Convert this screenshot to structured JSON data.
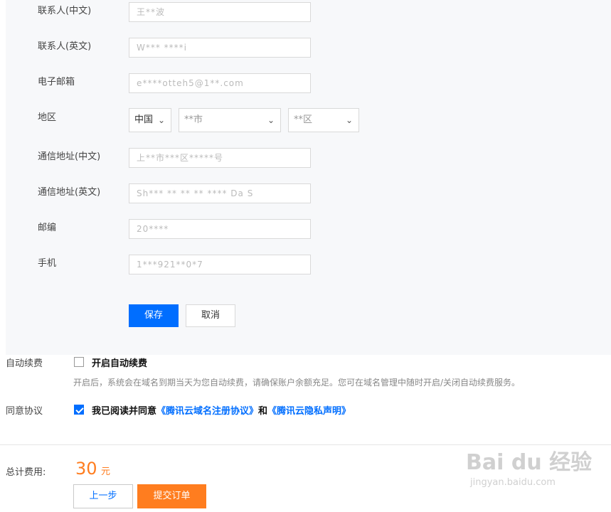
{
  "form": {
    "fields": [
      {
        "label": "联系人(中文)",
        "value": "王**波"
      },
      {
        "label": "联系人(英文)",
        "value": "W*** ****i"
      },
      {
        "label": "电子邮箱",
        "value": "e****otteh5@1**.com"
      },
      {
        "label": "通信地址(中文)",
        "value": "上**市***区*****号"
      },
      {
        "label": "通信地址(英文)",
        "value": "Sh*** ** ** ** **** Da S"
      },
      {
        "label": "邮编",
        "value": "20****"
      },
      {
        "label": "手机",
        "value": "1***921**0*7"
      }
    ],
    "region": {
      "label": "地区",
      "country": "中国",
      "province": "**市",
      "city": "**区"
    },
    "save_label": "保存",
    "cancel_label": "取消"
  },
  "auto_renew": {
    "label": "自动续费",
    "checkbox_label": "开启自动续费",
    "checked": false,
    "description": "开启后，系统会在域名到期当天为您自动续费，请确保账户余额充足。您可在域名管理中随时开启/关闭自动续费服务。"
  },
  "agreement": {
    "label": "同意协议",
    "checked": true,
    "prefix": "我已阅读并同意",
    "link1": "《腾讯云域名注册协议》",
    "middle": "和",
    "link2": "《腾讯云隐私声明》"
  },
  "total": {
    "label": "总计费用:",
    "amount": "30",
    "unit": "元"
  },
  "actions": {
    "prev_label": "上一步",
    "submit_label": "提交订单"
  },
  "watermark": {
    "text": "Bai du 经验",
    "url": "jingyan.baidu.com"
  },
  "colors": {
    "primary": "#006eff",
    "orange": "#ff7d1f",
    "panel_bg": "#f7f8fa"
  }
}
